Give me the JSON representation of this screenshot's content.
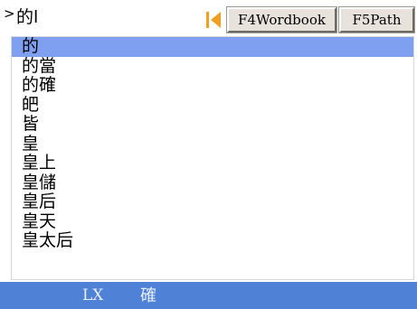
{
  "input": {
    "prompt": ">",
    "text": "的l"
  },
  "toolbar": {
    "prev_icon": "orange-prev-triangle",
    "wordbook_label": "F4Wordbook",
    "path_label": "F5Path",
    "accent_color": "#f0a020"
  },
  "candidates": {
    "selected_index": 0,
    "selected_color": "#7f9ff0",
    "items": [
      "的",
      "的當",
      "的確",
      "皅",
      "皆",
      "皇",
      "皇上",
      "皇儲",
      "皇后",
      "皇天",
      "皇太后"
    ]
  },
  "status": {
    "code": "LX",
    "char": "確",
    "bar_color": "#4f81d6"
  }
}
